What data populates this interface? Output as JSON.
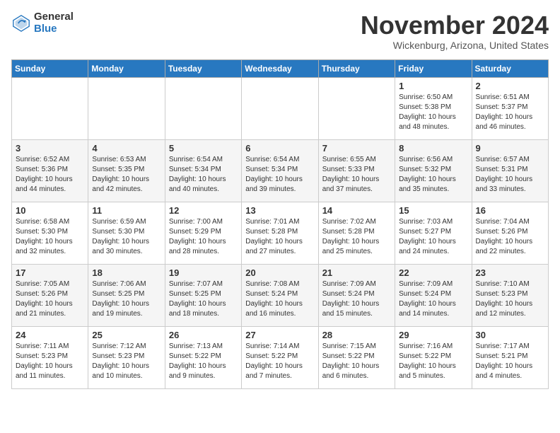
{
  "header": {
    "logo_general": "General",
    "logo_blue": "Blue",
    "month_title": "November 2024",
    "location": "Wickenburg, Arizona, United States"
  },
  "days_of_week": [
    "Sunday",
    "Monday",
    "Tuesday",
    "Wednesday",
    "Thursday",
    "Friday",
    "Saturday"
  ],
  "weeks": [
    [
      {
        "day": "",
        "info": ""
      },
      {
        "day": "",
        "info": ""
      },
      {
        "day": "",
        "info": ""
      },
      {
        "day": "",
        "info": ""
      },
      {
        "day": "",
        "info": ""
      },
      {
        "day": "1",
        "info": "Sunrise: 6:50 AM\nSunset: 5:38 PM\nDaylight: 10 hours\nand 48 minutes."
      },
      {
        "day": "2",
        "info": "Sunrise: 6:51 AM\nSunset: 5:37 PM\nDaylight: 10 hours\nand 46 minutes."
      }
    ],
    [
      {
        "day": "3",
        "info": "Sunrise: 6:52 AM\nSunset: 5:36 PM\nDaylight: 10 hours\nand 44 minutes."
      },
      {
        "day": "4",
        "info": "Sunrise: 6:53 AM\nSunset: 5:35 PM\nDaylight: 10 hours\nand 42 minutes."
      },
      {
        "day": "5",
        "info": "Sunrise: 6:54 AM\nSunset: 5:34 PM\nDaylight: 10 hours\nand 40 minutes."
      },
      {
        "day": "6",
        "info": "Sunrise: 6:54 AM\nSunset: 5:34 PM\nDaylight: 10 hours\nand 39 minutes."
      },
      {
        "day": "7",
        "info": "Sunrise: 6:55 AM\nSunset: 5:33 PM\nDaylight: 10 hours\nand 37 minutes."
      },
      {
        "day": "8",
        "info": "Sunrise: 6:56 AM\nSunset: 5:32 PM\nDaylight: 10 hours\nand 35 minutes."
      },
      {
        "day": "9",
        "info": "Sunrise: 6:57 AM\nSunset: 5:31 PM\nDaylight: 10 hours\nand 33 minutes."
      }
    ],
    [
      {
        "day": "10",
        "info": "Sunrise: 6:58 AM\nSunset: 5:30 PM\nDaylight: 10 hours\nand 32 minutes."
      },
      {
        "day": "11",
        "info": "Sunrise: 6:59 AM\nSunset: 5:30 PM\nDaylight: 10 hours\nand 30 minutes."
      },
      {
        "day": "12",
        "info": "Sunrise: 7:00 AM\nSunset: 5:29 PM\nDaylight: 10 hours\nand 28 minutes."
      },
      {
        "day": "13",
        "info": "Sunrise: 7:01 AM\nSunset: 5:28 PM\nDaylight: 10 hours\nand 27 minutes."
      },
      {
        "day": "14",
        "info": "Sunrise: 7:02 AM\nSunset: 5:28 PM\nDaylight: 10 hours\nand 25 minutes."
      },
      {
        "day": "15",
        "info": "Sunrise: 7:03 AM\nSunset: 5:27 PM\nDaylight: 10 hours\nand 24 minutes."
      },
      {
        "day": "16",
        "info": "Sunrise: 7:04 AM\nSunset: 5:26 PM\nDaylight: 10 hours\nand 22 minutes."
      }
    ],
    [
      {
        "day": "17",
        "info": "Sunrise: 7:05 AM\nSunset: 5:26 PM\nDaylight: 10 hours\nand 21 minutes."
      },
      {
        "day": "18",
        "info": "Sunrise: 7:06 AM\nSunset: 5:25 PM\nDaylight: 10 hours\nand 19 minutes."
      },
      {
        "day": "19",
        "info": "Sunrise: 7:07 AM\nSunset: 5:25 PM\nDaylight: 10 hours\nand 18 minutes."
      },
      {
        "day": "20",
        "info": "Sunrise: 7:08 AM\nSunset: 5:24 PM\nDaylight: 10 hours\nand 16 minutes."
      },
      {
        "day": "21",
        "info": "Sunrise: 7:09 AM\nSunset: 5:24 PM\nDaylight: 10 hours\nand 15 minutes."
      },
      {
        "day": "22",
        "info": "Sunrise: 7:09 AM\nSunset: 5:24 PM\nDaylight: 10 hours\nand 14 minutes."
      },
      {
        "day": "23",
        "info": "Sunrise: 7:10 AM\nSunset: 5:23 PM\nDaylight: 10 hours\nand 12 minutes."
      }
    ],
    [
      {
        "day": "24",
        "info": "Sunrise: 7:11 AM\nSunset: 5:23 PM\nDaylight: 10 hours\nand 11 minutes."
      },
      {
        "day": "25",
        "info": "Sunrise: 7:12 AM\nSunset: 5:23 PM\nDaylight: 10 hours\nand 10 minutes."
      },
      {
        "day": "26",
        "info": "Sunrise: 7:13 AM\nSunset: 5:22 PM\nDaylight: 10 hours\nand 9 minutes."
      },
      {
        "day": "27",
        "info": "Sunrise: 7:14 AM\nSunset: 5:22 PM\nDaylight: 10 hours\nand 7 minutes."
      },
      {
        "day": "28",
        "info": "Sunrise: 7:15 AM\nSunset: 5:22 PM\nDaylight: 10 hours\nand 6 minutes."
      },
      {
        "day": "29",
        "info": "Sunrise: 7:16 AM\nSunset: 5:22 PM\nDaylight: 10 hours\nand 5 minutes."
      },
      {
        "day": "30",
        "info": "Sunrise: 7:17 AM\nSunset: 5:21 PM\nDaylight: 10 hours\nand 4 minutes."
      }
    ]
  ]
}
